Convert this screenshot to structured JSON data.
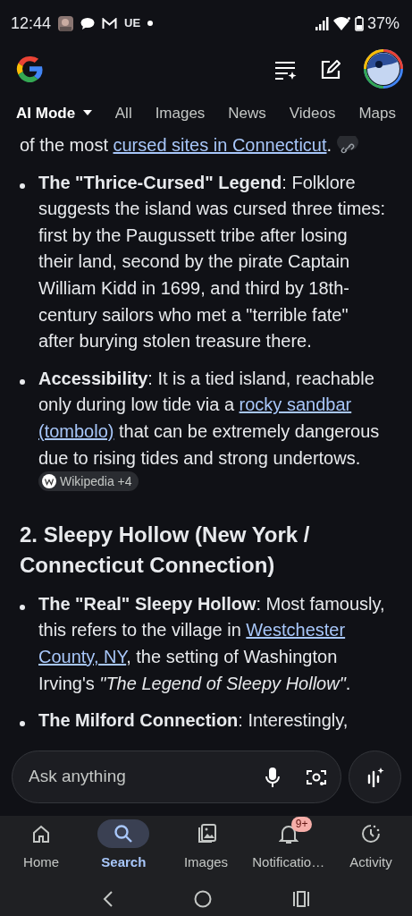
{
  "status_bar": {
    "time": "12:44",
    "carrier_label": "UE",
    "battery": "37%"
  },
  "tabs": [
    {
      "label": "AI Mode",
      "selected": true,
      "dropdown": true
    },
    {
      "label": "All",
      "selected": false
    },
    {
      "label": "Images",
      "selected": false
    },
    {
      "label": "News",
      "selected": false
    },
    {
      "label": "Videos",
      "selected": false
    },
    {
      "label": "Maps",
      "selected": false
    }
  ],
  "content": [
    {
      "kind": "paragraph",
      "parts": [
        {
          "kind": "text",
          "text": "of the most "
        },
        {
          "kind": "link",
          "text": "cursed sites in Connecticut"
        },
        {
          "kind": "text",
          "text": ". "
        },
        {
          "kind": "link_chip"
        }
      ]
    },
    {
      "kind": "bullet",
      "parts": [
        {
          "kind": "text",
          "text": "**The \"Thrice-Cursed\" Legend**: Folklore suggests the island was cursed three times: first by the Paugussett tribe after losing their land, second by the pirate Captain William Kidd in 1699, and third by 18th-century sailors who met a \"terrible fate\" after burying stolen treasure there."
        }
      ]
    },
    {
      "kind": "bullet",
      "parts": [
        {
          "kind": "text",
          "text": "**Accessibility**: It is a tied island, reachable only during low tide via a "
        },
        {
          "kind": "link",
          "text": "rocky sandbar"
        },
        {
          "kind": "link",
          "text": "(tombolo)"
        },
        {
          "kind": "text",
          "text": " that can be extremely dangerous due to rising tides and strong undertows. "
        },
        {
          "kind": "source_chip",
          "text": "Wikipedia +4"
        }
      ]
    },
    {
      "kind": "heading",
      "parts": [
        {
          "kind": "text",
          "text": "2. Sleepy Hollow (New York / Connecticut Connection)"
        }
      ]
    },
    {
      "kind": "bullet",
      "parts": [
        {
          "kind": "text",
          "text": "**The \"Real\" Sleepy Hollow**: Most famously, this refers to the village in "
        },
        {
          "kind": "link",
          "text": "Westchester"
        },
        {
          "kind": "link",
          "text": "County, NY"
        },
        {
          "kind": "text",
          "text": ", the setting of Washington Irving's *\"The Legend of Sleepy Hollow\"*."
        }
      ]
    },
    {
      "kind": "bullet",
      "parts": [
        {
          "kind": "text",
          "text": "**The Milford Connection**: Interestingly,"
        }
      ]
    }
  ],
  "search": {
    "placeholder": "Ask anything"
  },
  "bottom_nav": [
    {
      "label": "Home",
      "selected": false
    },
    {
      "label": "Search",
      "selected": true
    },
    {
      "label": "Images",
      "selected": false
    },
    {
      "label": "Notificatio…",
      "selected": false,
      "badge": "9+"
    },
    {
      "label": "Activity",
      "selected": false
    }
  ]
}
